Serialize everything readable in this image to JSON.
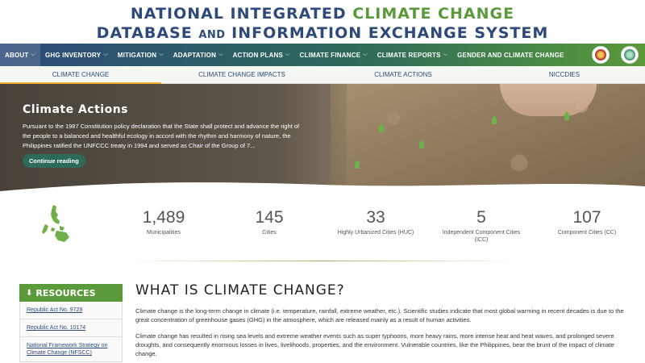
{
  "header": {
    "title_line1_a": "NATIONAL INTEGRATED ",
    "title_line1_b": "CLIMATE CHANGE",
    "title_line2_a": "DATABASE ",
    "title_line2_and": "AND",
    "title_line2_b": " INFORMATION EXCHANGE SYSTEM"
  },
  "nav": {
    "items": [
      {
        "label": "ABOUT"
      },
      {
        "label": "GHG INVENTORY"
      },
      {
        "label": "MITIGATION"
      },
      {
        "label": "ADAPTATION"
      },
      {
        "label": "ACTION PLANS"
      },
      {
        "label": "CLIMATE FINANCE"
      },
      {
        "label": "CLIMATE REPORTS"
      },
      {
        "label": "GENDER AND CLIMATE CHANGE"
      }
    ]
  },
  "subnav": {
    "items": [
      {
        "label": "CLIMATE CHANGE"
      },
      {
        "label": "CLIMATE CHANGE IMPACTS"
      },
      {
        "label": "CLIMATE ACTIONS"
      },
      {
        "label": "NICCDIES"
      }
    ]
  },
  "hero": {
    "title": "Climate Actions",
    "text": "Pursuant to the 1987 Constitution policy declaration that the State shall protect and advance the right of the people to a balanced and healthful ecology in accord with the rhythm and harmony of nature, the Philippines ratified the UNFCCC treaty in 1994 and served as Chair of the Group of 7...",
    "button": "Continue reading"
  },
  "stats": [
    {
      "num": "1,489",
      "label": "Municipalities"
    },
    {
      "num": "145",
      "label": "Cities"
    },
    {
      "num": "33",
      "label": "Highly Urbanized Cities (HUC)"
    },
    {
      "num": "5",
      "label": "Independent Component Cities (ICC)"
    },
    {
      "num": "107",
      "label": "Component Cities (CC)"
    }
  ],
  "sidebar": {
    "heading": "RESOURCES",
    "links": [
      {
        "label": "Republic Act No. 9729"
      },
      {
        "label": "Republic Act No. 10174"
      },
      {
        "label": "National Framework Strategy on Climate Change (NFSCC)"
      }
    ]
  },
  "main": {
    "title": "WHAT IS CLIMATE CHANGE?",
    "p1": "Climate change is the long-term change in climate (i.e. temperature, rainfall, extreme weather, etc.). Scientific studies indicate that most global warming in recent decades is due to the great concentration of greenhouse gases (GHG) in the atmosphere, which are released mainly as a result of human activities.",
    "p2": "Climate change has resulted in rising sea levels and extreme weather events such as super typhoons, more heavy rains, more intense heat and heat waves, and prolonged severe droughts, and consequently enormous losses in lives, livelihoods, properties, and the environment. Vulnerable countries, like the Philippines, bear the brunt of the impact of climate change."
  },
  "colors": {
    "brand_blue": "#2d4a7a",
    "brand_green": "#5a9a3a",
    "accent_orange": "#f2b233"
  }
}
